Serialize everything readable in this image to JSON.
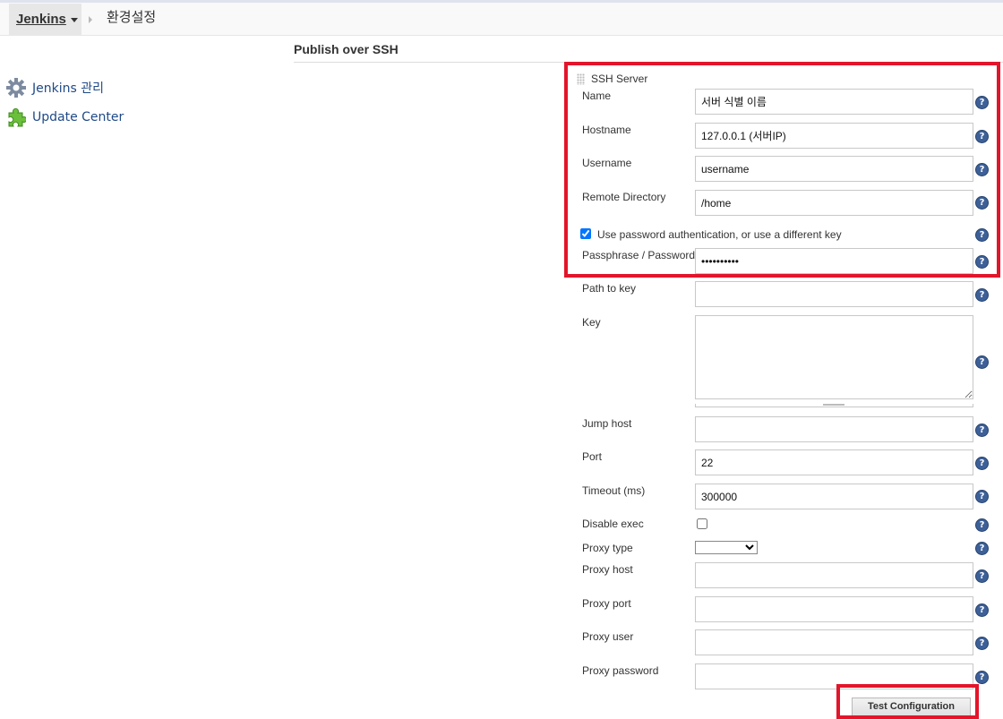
{
  "breadcrumb": {
    "root_label": "Jenkins",
    "page_label": "환경설정"
  },
  "sidebar": {
    "items": [
      {
        "label": "Jenkins 관리",
        "icon": "gear-icon"
      },
      {
        "label": "Update Center",
        "icon": "puzzle-piece-icon"
      }
    ]
  },
  "section": {
    "title": "Publish over SSH",
    "server_heading": "SSH Server"
  },
  "form": {
    "name": {
      "label": "Name",
      "value": "서버 식별 이름"
    },
    "hostname": {
      "label": "Hostname",
      "value": "127.0.0.1 (서버IP)"
    },
    "username": {
      "label": "Username",
      "value": "username"
    },
    "remote_directory": {
      "label": "Remote Directory",
      "value": "/home"
    },
    "use_password": {
      "label": "Use password authentication, or use a different key",
      "checked": true
    },
    "passphrase": {
      "label": "Passphrase / Password",
      "value": "••••••••••"
    },
    "path_to_key": {
      "label": "Path to key",
      "value": ""
    },
    "key": {
      "label": "Key",
      "value": ""
    },
    "jump_host": {
      "label": "Jump host",
      "value": ""
    },
    "port": {
      "label": "Port",
      "value": "22"
    },
    "timeout": {
      "label": "Timeout (ms)",
      "value": "300000"
    },
    "disable_exec": {
      "label": "Disable exec",
      "checked": false
    },
    "proxy_type": {
      "label": "Proxy type",
      "value": ""
    },
    "proxy_host": {
      "label": "Proxy host",
      "value": ""
    },
    "proxy_port": {
      "label": "Proxy port",
      "value": ""
    },
    "proxy_user": {
      "label": "Proxy user",
      "value": ""
    },
    "proxy_password": {
      "label": "Proxy password",
      "value": ""
    }
  },
  "buttons": {
    "test_configuration": "Test Configuration"
  },
  "help_glyph": "?",
  "colors": {
    "highlight_red": "#e3152b",
    "help_blue": "#3d6098",
    "link_blue": "#204a87"
  }
}
